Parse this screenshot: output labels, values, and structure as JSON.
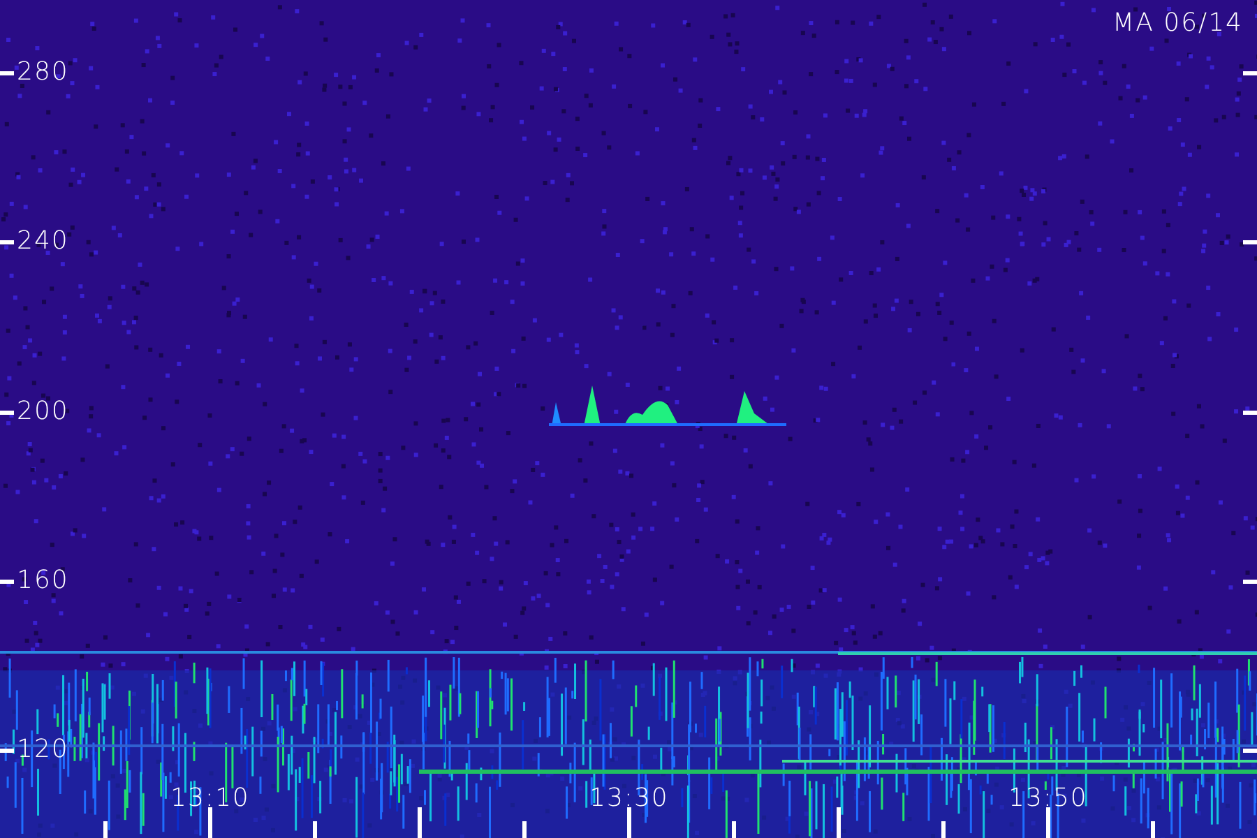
{
  "stamp": "MA 06/14",
  "y_axis": {
    "ticks": [
      "280",
      "240",
      "200",
      "160",
      "120"
    ]
  },
  "x_axis": {
    "ticks": [
      "13:10",
      "13:30",
      "13:50"
    ]
  }
}
